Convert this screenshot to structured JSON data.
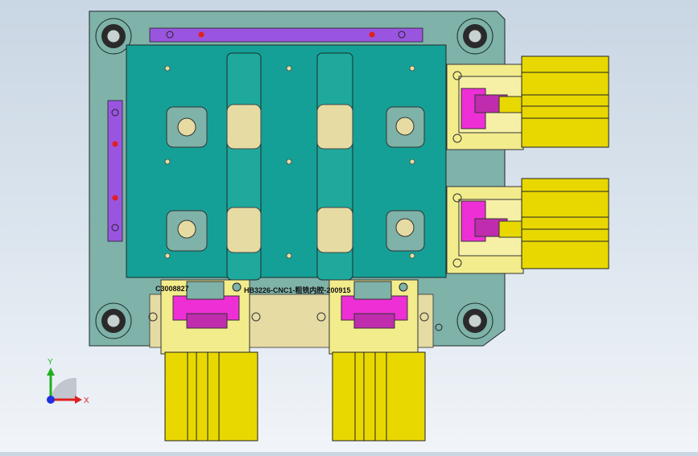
{
  "part_labels": {
    "left_code": "C3008827",
    "drawing_title": "HB3226-CNC1-粗铣内腔-200915"
  },
  "triad": {
    "x_label": "X",
    "y_label": "Y",
    "x_color": "#e02020",
    "y_color": "#20b020",
    "z_color": "#2030e0"
  },
  "colors": {
    "base_plate": "#7fb2a8",
    "top_plate": "#14a096",
    "guide_strip": "#1fa99d",
    "pad": "#e6dca3",
    "clamp_yellow": "#f3ec8c",
    "cylinder": "#e8d800",
    "clamp_magenta": "#ee2fd6",
    "purple_bar": "#9a55e0",
    "dowel_red": "#e02020",
    "bushing": "#2a2a2a"
  }
}
